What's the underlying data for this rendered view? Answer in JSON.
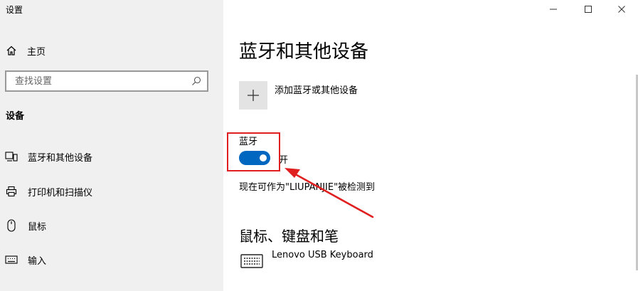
{
  "window": {
    "title": "设置"
  },
  "sidebar": {
    "home_label": "主页",
    "search_placeholder": "查找设置",
    "section_heading": "设备",
    "items": [
      {
        "label": "蓝牙和其他设备",
        "icon": "devices-icon"
      },
      {
        "label": "打印机和扫描仪",
        "icon": "printer-icon"
      },
      {
        "label": "鼠标",
        "icon": "mouse-icon"
      },
      {
        "label": "输入",
        "icon": "keyboard-icon"
      }
    ]
  },
  "main": {
    "page_title": "蓝牙和其他设备",
    "add_device_label": "添加蓝牙或其他设备",
    "bluetooth": {
      "label": "蓝牙",
      "state_label": "开",
      "on": true
    },
    "discoverable_text": "现在可作为\"LIUPANJIE\"被检测到",
    "section2_title": "鼠标、键盘和笔",
    "device_name": "Lenovo USB Keyboard"
  },
  "colors": {
    "accent": "#0067c0",
    "annotation": "#e02020",
    "sidebar_bg": "#f0f0f0"
  }
}
